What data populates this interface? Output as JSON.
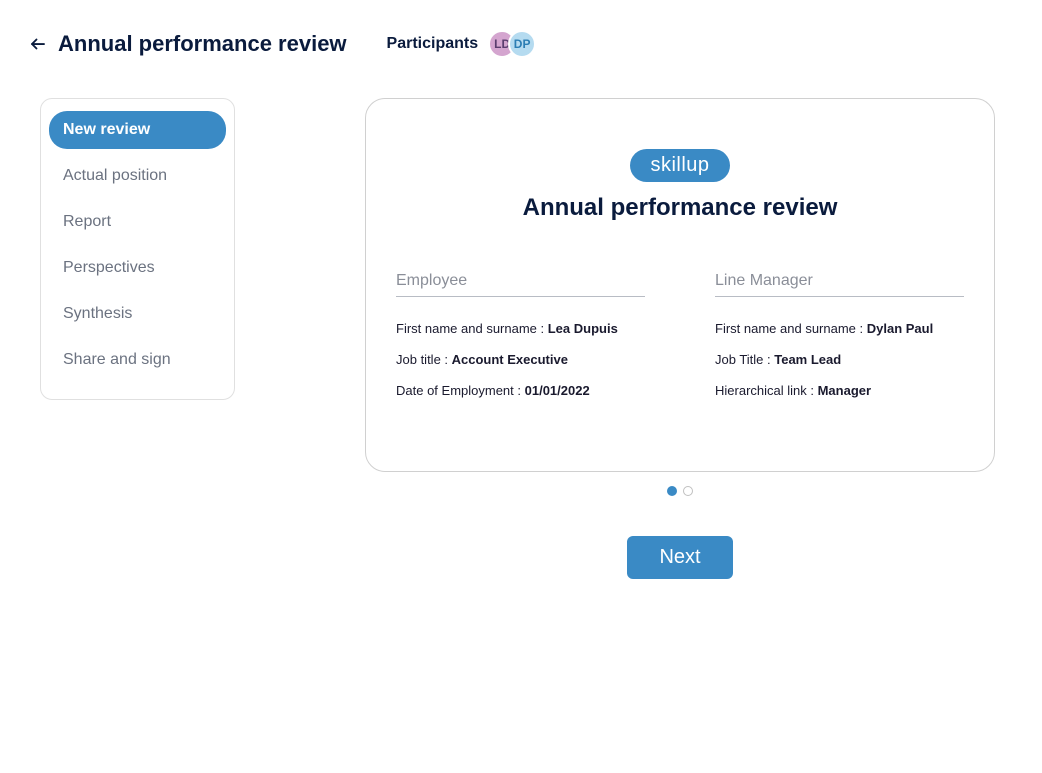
{
  "header": {
    "title": "Annual performance review",
    "participants_label": "Participants",
    "participants": [
      {
        "initials": "LD"
      },
      {
        "initials": "DP"
      }
    ]
  },
  "sidebar": {
    "items": [
      {
        "label": "New review",
        "active": true
      },
      {
        "label": "Actual position",
        "active": false
      },
      {
        "label": "Report",
        "active": false
      },
      {
        "label": "Perspectives",
        "active": false
      },
      {
        "label": "Synthesis",
        "active": false
      },
      {
        "label": "Share and sign",
        "active": false
      }
    ]
  },
  "card": {
    "badge": "skillup",
    "title": "Annual performance review",
    "employee": {
      "section_label": "Employee",
      "name_label": "First name and surname : ",
      "name_value": "Lea Dupuis",
      "job_label": "Job title : ",
      "job_value": "Account Executive",
      "date_label": "Date of Employment : ",
      "date_value": "01/01/2022"
    },
    "manager": {
      "section_label": "Line Manager",
      "name_label": "First name and surname : ",
      "name_value": "Dylan Paul",
      "job_label": "Job Title : ",
      "job_value": "Team Lead",
      "link_label": "Hierarchical link :  ",
      "link_value": "Manager"
    }
  },
  "actions": {
    "next_label": "Next"
  }
}
